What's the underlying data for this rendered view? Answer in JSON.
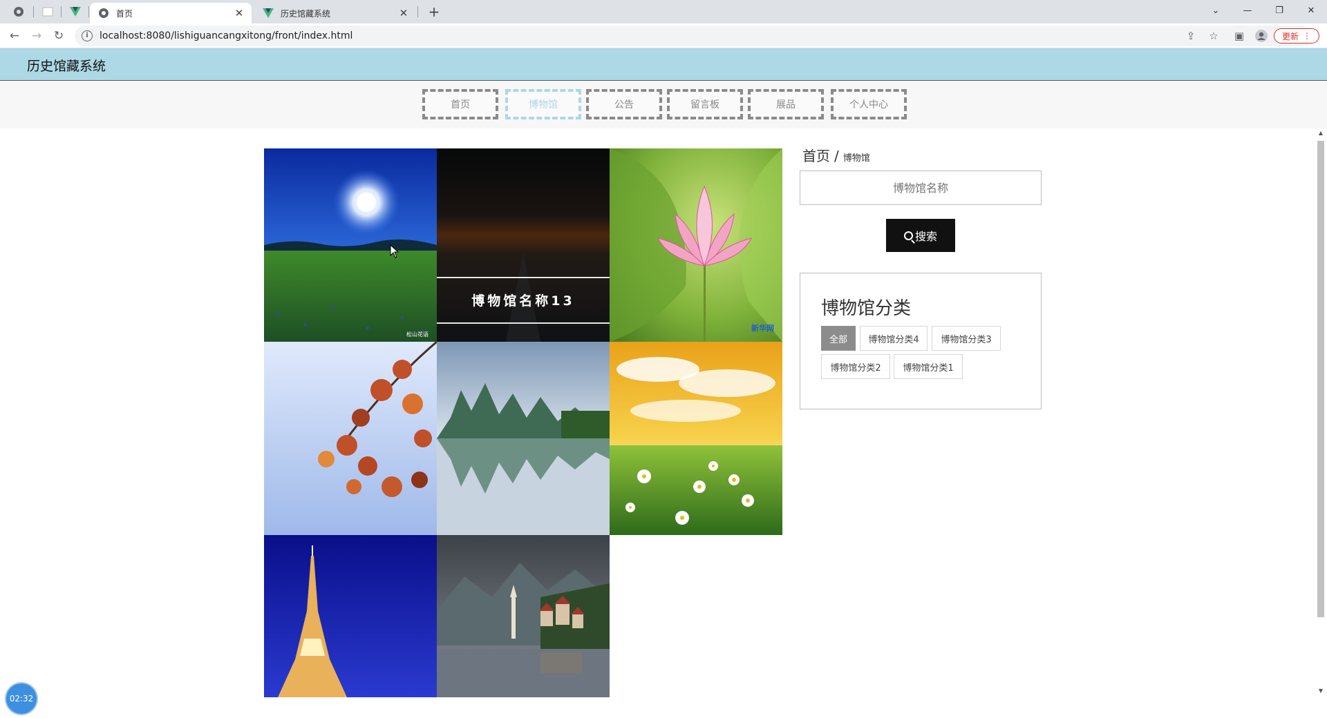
{
  "browser": {
    "tabs": [
      {
        "title": "首页",
        "active": true
      },
      {
        "title": "历史馆藏系统",
        "active": false
      }
    ],
    "url": "localhost:8080/lishiguancangxitong/front/index.html",
    "update_label": "更新"
  },
  "site": {
    "title": "历史馆藏系统"
  },
  "nav": {
    "items": [
      {
        "label": "首页"
      },
      {
        "label": "博物馆",
        "active": true
      },
      {
        "label": "公告"
      },
      {
        "label": "留言板"
      },
      {
        "label": "展品"
      },
      {
        "label": "个人中心"
      }
    ]
  },
  "gallery": {
    "items": [
      {
        "image": "moonlit-meadow-photo",
        "watermark": "松山花语"
      },
      {
        "image": "dark-sunset-photo",
        "name": "博物馆名称13",
        "hovered": true
      },
      {
        "image": "pink-lotus-photo",
        "watermark": "新华网"
      },
      {
        "image": "autumn-leaves-photo"
      },
      {
        "image": "karst-river-reflection-photo"
      },
      {
        "image": "daisy-field-sunset-photo"
      },
      {
        "image": "eiffel-tower-night-photo"
      },
      {
        "image": "lakeside-village-photo"
      }
    ]
  },
  "breadcrumb": {
    "home": "首页",
    "separator": "/",
    "current": "博物馆"
  },
  "search": {
    "placeholder": "博物馆名称",
    "button_label": "搜索"
  },
  "categories": {
    "title": "博物馆分类",
    "items": [
      {
        "label": "全部",
        "active": true
      },
      {
        "label": "博物馆分类4"
      },
      {
        "label": "博物馆分类3"
      },
      {
        "label": "博物馆分类2"
      },
      {
        "label": "博物馆分类1"
      }
    ]
  },
  "timer": "02:32",
  "colors": {
    "header_bg": "#add8e6",
    "nav_active": "#add8e6",
    "search_button": "#111111",
    "category_active": "#8c8c8c",
    "update_red": "#d93025"
  }
}
